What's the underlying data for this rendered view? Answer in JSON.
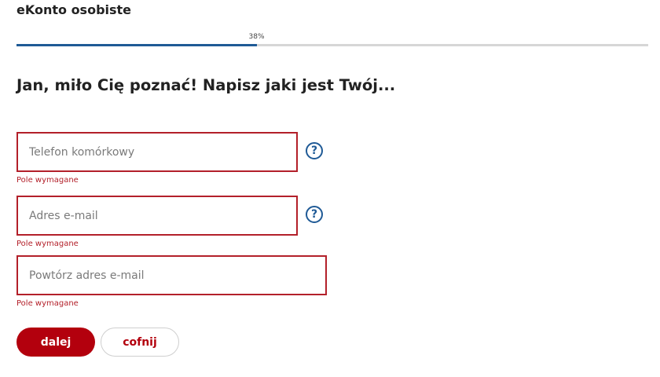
{
  "header": {
    "title": "eKonto osobiste"
  },
  "progress": {
    "percent_label": "38%",
    "value": 0.38
  },
  "heading": "Jan, miło Cię poznać! Napisz jaki jest Twój...",
  "form": {
    "phone": {
      "placeholder": "Telefon komórkowy",
      "value": "",
      "error": "Pole wymagane",
      "help_icon": "?"
    },
    "email": {
      "placeholder": "Adres e-mail",
      "value": "",
      "error": "Pole wymagane",
      "help_icon": "?"
    },
    "email_repeat": {
      "placeholder": "Powtórz adres e-mail",
      "value": "",
      "error": "Pole wymagane"
    }
  },
  "buttons": {
    "next": "dalej",
    "back": "cofnij"
  },
  "colors": {
    "accent": "#1f5a96",
    "error": "#b3202a",
    "primary": "#b3000d"
  }
}
